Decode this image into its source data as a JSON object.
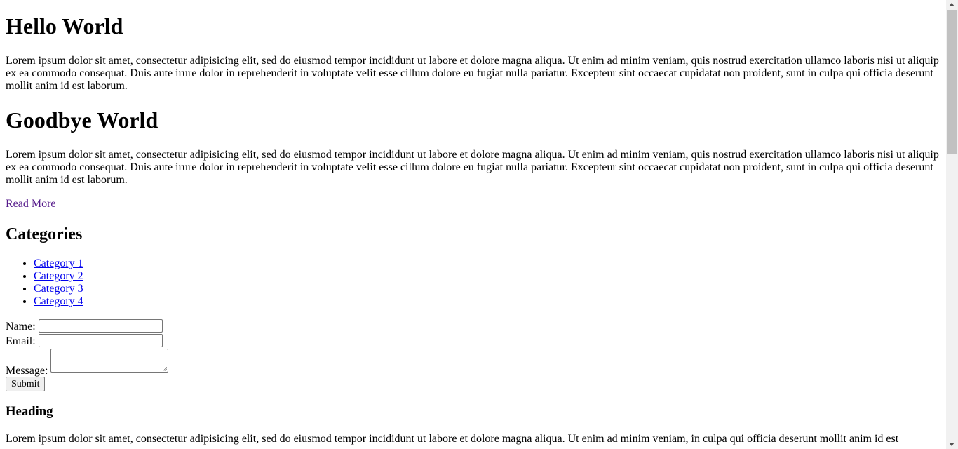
{
  "article1": {
    "title": "Hello World",
    "body": "Lorem ipsum dolor sit amet, consectetur adipisicing elit, sed do eiusmod tempor incididunt ut labore et dolore magna aliqua. Ut enim ad minim veniam, quis nostrud exercitation ullamco laboris nisi ut aliquip ex ea commodo consequat. Duis aute irure dolor in reprehenderit in voluptate velit esse cillum dolore eu fugiat nulla pariatur. Excepteur sint occaecat cupidatat non proident, sunt in culpa qui officia deserunt mollit anim id est laborum."
  },
  "article2": {
    "title": "Goodbye World",
    "body": "Lorem ipsum dolor sit amet, consectetur adipisicing elit, sed do eiusmod tempor incididunt ut labore et dolore magna aliqua. Ut enim ad minim veniam, quis nostrud exercitation ullamco laboris nisi ut aliquip ex ea commodo consequat. Duis aute irure dolor in reprehenderit in voluptate velit esse cillum dolore eu fugiat nulla pariatur. Excepteur sint occaecat cupidatat non proident, sunt in culpa qui officia deserunt mollit anim id est laborum.",
    "read_more": "Read More"
  },
  "categories": {
    "title": "Categories",
    "items": [
      {
        "label": "Category 1"
      },
      {
        "label": "Category 2"
      },
      {
        "label": "Category 3"
      },
      {
        "label": "Category 4"
      }
    ]
  },
  "form": {
    "name_label": "Name:",
    "name_value": "",
    "email_label": "Email:",
    "email_value": "",
    "message_label": "Message:",
    "message_value": "",
    "submit_label": "Submit"
  },
  "section3": {
    "title": "Heading",
    "body": "Lorem ipsum dolor sit amet, consectetur adipisicing elit, sed do eiusmod tempor incididunt ut labore et dolore magna aliqua. Ut enim ad minim veniam, in culpa qui officia deserunt mollit anim id est"
  },
  "colors": {
    "link": "#0000ee",
    "visited_link": "#551a8b",
    "scrollbar_track": "#f1f1f1",
    "scrollbar_thumb": "#c1c1c1"
  }
}
